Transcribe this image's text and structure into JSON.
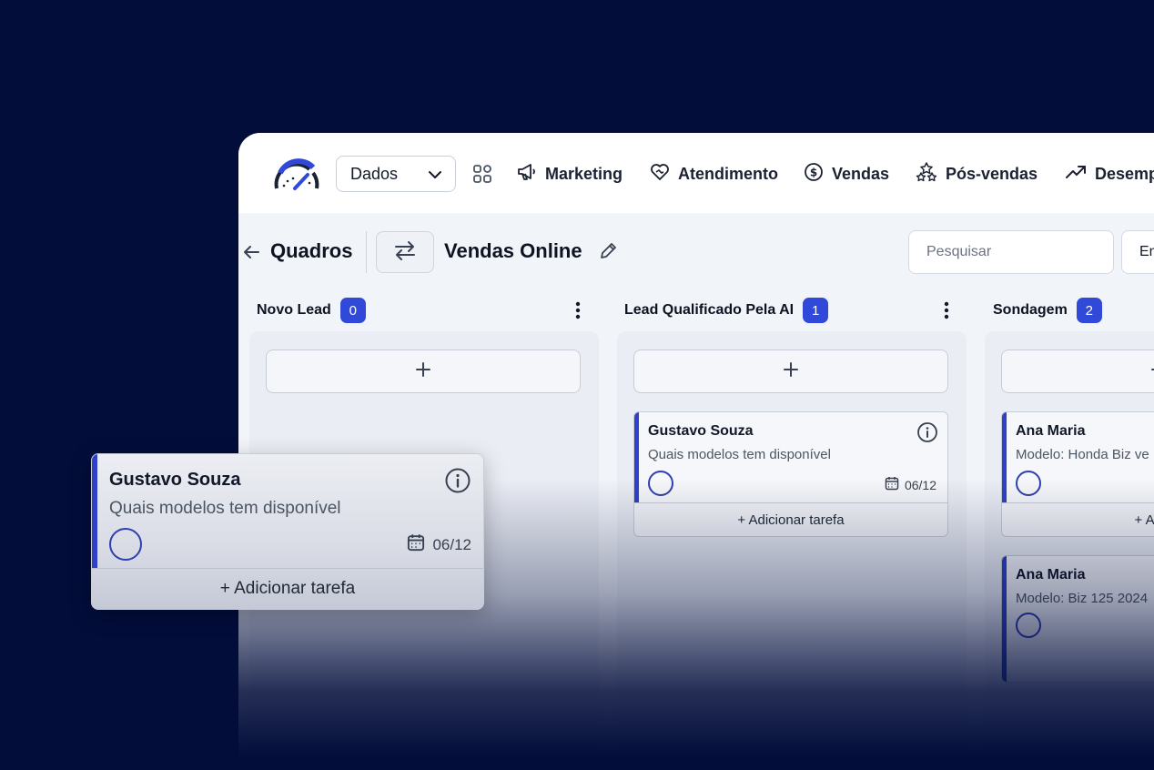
{
  "topbar": {
    "select_value": "Dados",
    "nav": [
      {
        "label": "Marketing",
        "icon": "megaphone-icon"
      },
      {
        "label": "Atendimento",
        "icon": "heart-handshake-icon"
      },
      {
        "label": "Vendas",
        "icon": "dollar-circle-icon"
      },
      {
        "label": "Pós-vendas",
        "icon": "stars-icon"
      },
      {
        "label": "Desemp",
        "icon": "trending-up-icon"
      }
    ]
  },
  "header": {
    "back_label": "Quadros",
    "board_title": "Vendas Online",
    "search_placeholder": "Pesquisar",
    "em_label": "Em"
  },
  "columns": [
    {
      "title": "Novo Lead",
      "count": "0",
      "add_symbol": "+",
      "cards": []
    },
    {
      "title": "Lead Qualificado Pela AI",
      "count": "1",
      "add_symbol": "+",
      "cards": [
        {
          "name": "Gustavo Souza",
          "desc": "Quais modelos tem disponível",
          "date": "06/12",
          "footer": "+ Adicionar tarefa"
        }
      ]
    },
    {
      "title": "Sondagem",
      "count": "2",
      "add_symbol": "+",
      "cards": [
        {
          "name": "Ana Maria",
          "desc": "Modelo: Honda Biz ve",
          "footer": "+ Adicio"
        },
        {
          "name": "Ana Maria",
          "desc": "Modelo: Biz 125 2024"
        }
      ]
    }
  ],
  "dragging_card": {
    "name": "Gustavo Souza",
    "desc": "Quais modelos tem disponível",
    "date": "06/12",
    "footer": "+ Adicionar tarefa"
  },
  "colors": {
    "background": "#020d3a",
    "accent": "#3149d8",
    "card_accent": "#2f41c9"
  }
}
